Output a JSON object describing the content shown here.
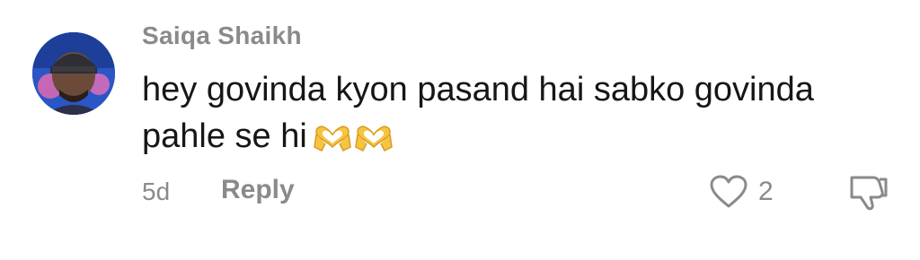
{
  "comment": {
    "author": "Saiqa Shaikh",
    "text_line1": "hey govinda kyon pasand hai sabko govinda",
    "text_line2": "pahle se hi",
    "emojis": [
      "heart-hands-emoji",
      "heart-hands-emoji"
    ],
    "timestamp": "5d",
    "reply_label": "Reply",
    "like_count": "2"
  },
  "icons": {
    "like": "heart-outline-icon",
    "dislike": "thumbs-down-icon"
  },
  "colors": {
    "muted_text": "#8a8a8a",
    "body_text": "#161616",
    "emoji_yellow": "#f5c542"
  }
}
